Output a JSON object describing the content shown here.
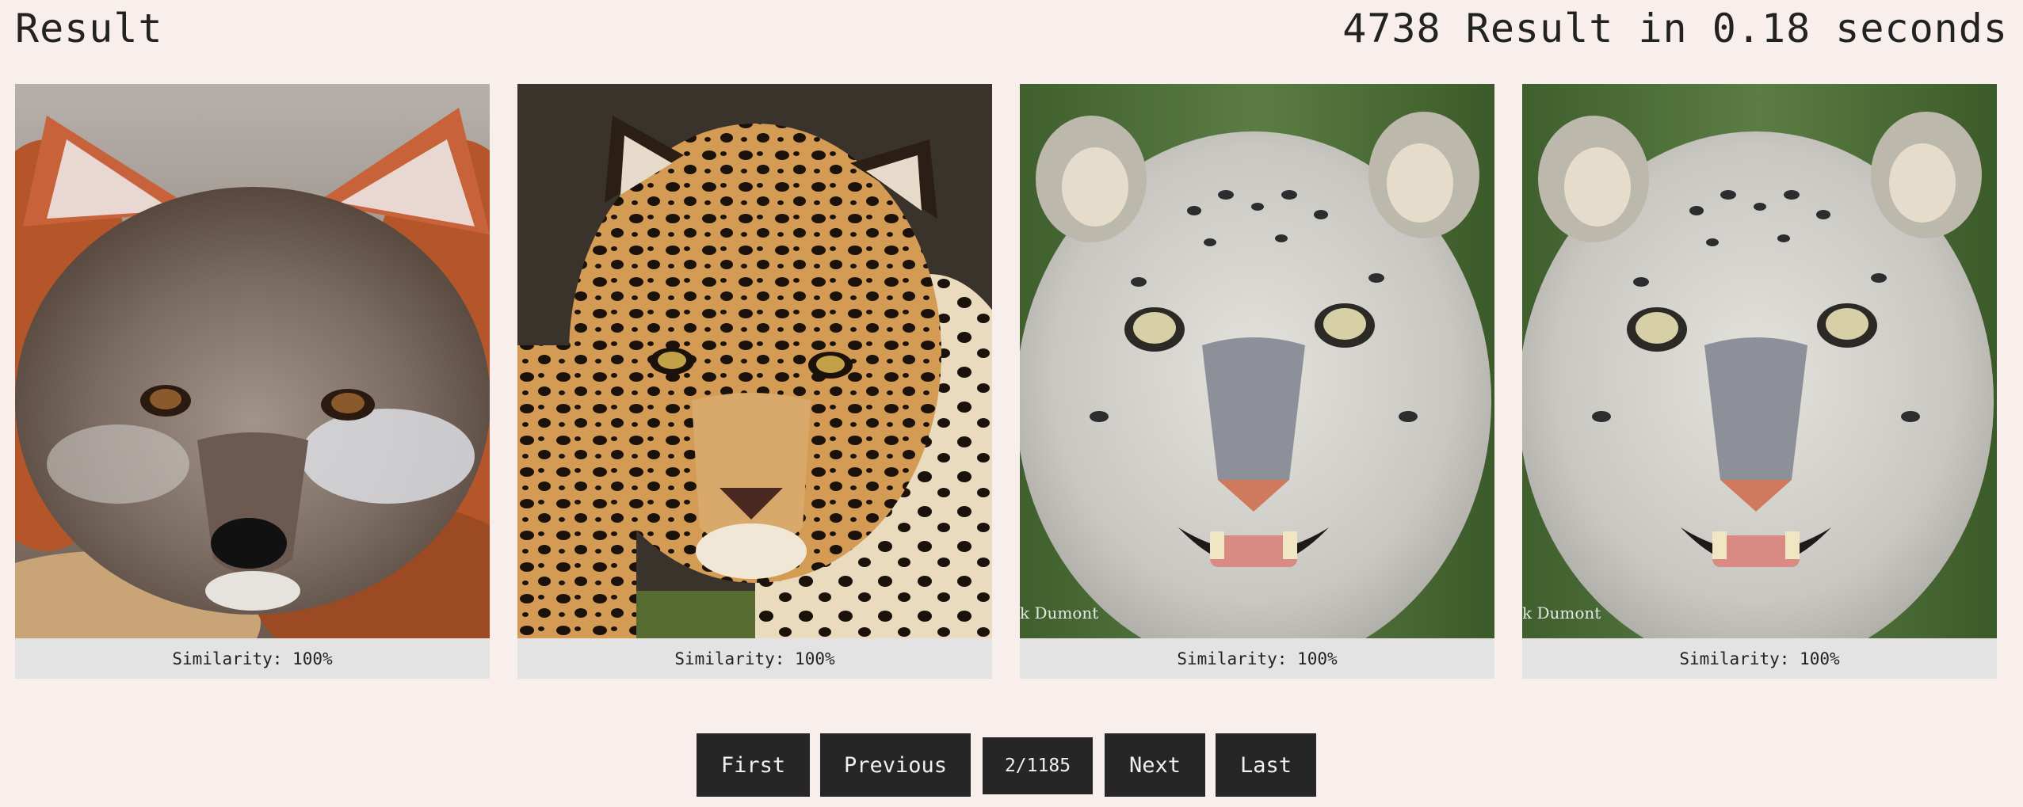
{
  "header": {
    "title": "Result",
    "summary": "4738 Result in 0.18 seconds"
  },
  "results": [
    {
      "image_icon": "fox-photo-icon",
      "similarity": "Similarity: 100%"
    },
    {
      "image_icon": "jaguar-photo-icon",
      "similarity": "Similarity: 100%"
    },
    {
      "image_icon": "snow-leopard-photo-icon",
      "similarity": "Similarity: 100%",
      "watermark": "k Dumont"
    },
    {
      "image_icon": "snow-leopard-photo-icon",
      "similarity": "Similarity: 100%",
      "watermark": "k Dumont"
    }
  ],
  "pagination": {
    "first": "First",
    "previous": "Previous",
    "page": "2/1185",
    "next": "Next",
    "last": "Last"
  },
  "colors": {
    "background": "#f8eeeb",
    "button": "#262626",
    "caption_bg": "#e3e3e3"
  }
}
